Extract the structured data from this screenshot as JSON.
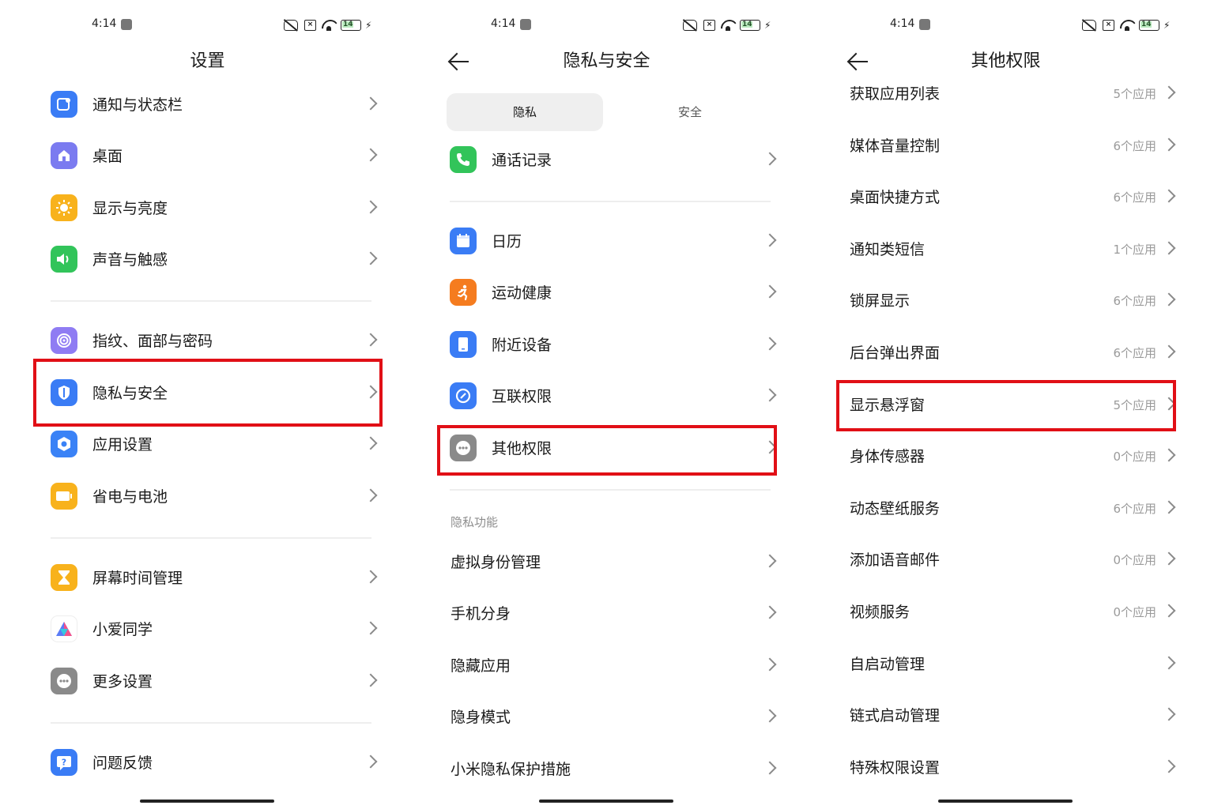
{
  "status_bar": {
    "time": "4:14",
    "battery": "14",
    "charging_symbol": "⚡"
  },
  "panel1": {
    "title": "设置",
    "items": [
      {
        "label": "通知与状态栏",
        "icon": "notification-icon",
        "color": "#3a7cf5"
      },
      {
        "label": "桌面",
        "icon": "home-icon",
        "color": "#7b7bf0"
      },
      {
        "label": "显示与亮度",
        "icon": "sun-icon",
        "color": "#f8b21c"
      },
      {
        "label": "声音与触感",
        "icon": "speaker-icon",
        "color": "#32c45a"
      },
      {
        "label": "指纹、面部与密码",
        "icon": "fingerprint-icon",
        "color": "#8f7cf3"
      },
      {
        "label": "隐私与安全",
        "icon": "shield-icon",
        "color": "#3a7cf5"
      },
      {
        "label": "应用设置",
        "icon": "app-settings-icon",
        "color": "#3a82f6"
      },
      {
        "label": "省电与电池",
        "icon": "battery-icon",
        "color": "#f8b21c"
      },
      {
        "label": "屏幕时间管理",
        "icon": "hourglass-icon",
        "color": "#f8b21c"
      },
      {
        "label": "小爱同学",
        "icon": "xiaoai-icon",
        "color": "#ffffff"
      },
      {
        "label": "更多设置",
        "icon": "more-icon",
        "color": "#8a8a8a"
      },
      {
        "label": "问题反馈",
        "icon": "feedback-icon",
        "color": "#3a7cf5"
      }
    ]
  },
  "panel2": {
    "title": "隐私与安全",
    "tabs": [
      "隐私",
      "安全"
    ],
    "items": [
      {
        "label": "通话记录",
        "icon": "phone-icon",
        "color": "#32c45a"
      },
      {
        "label": "日历",
        "icon": "calendar-icon",
        "color": "#3a7cf5"
      },
      {
        "label": "运动健康",
        "icon": "running-icon",
        "color": "#f57c1f"
      },
      {
        "label": "附近设备",
        "icon": "device-icon",
        "color": "#3a7cf5"
      },
      {
        "label": "互联权限",
        "icon": "link-icon",
        "color": "#3a7cf5"
      },
      {
        "label": "其他权限",
        "icon": "more-icon",
        "color": "#8a8a8a"
      }
    ],
    "section_label": "隐私功能",
    "section_items": [
      "虚拟身份管理",
      "手机分身",
      "隐藏应用",
      "隐身模式",
      "小米隐私保护措施"
    ]
  },
  "panel3": {
    "title": "其他权限",
    "items": [
      {
        "label": "获取应用列表",
        "count": "5个应用"
      },
      {
        "label": "媒体音量控制",
        "count": "6个应用"
      },
      {
        "label": "桌面快捷方式",
        "count": "6个应用"
      },
      {
        "label": "通知类短信",
        "count": "1个应用"
      },
      {
        "label": "锁屏显示",
        "count": "6个应用"
      },
      {
        "label": "后台弹出界面",
        "count": "6个应用"
      },
      {
        "label": "显示悬浮窗",
        "count": "5个应用"
      },
      {
        "label": "身体传感器",
        "count": "0个应用"
      },
      {
        "label": "动态壁纸服务",
        "count": "6个应用"
      },
      {
        "label": "添加语音邮件",
        "count": "0个应用"
      },
      {
        "label": "视频服务",
        "count": "0个应用"
      },
      {
        "label": "自启动管理",
        "count": ""
      },
      {
        "label": "链式启动管理",
        "count": ""
      },
      {
        "label": "特殊权限设置",
        "count": ""
      }
    ]
  },
  "highlight_color": "#e10f16"
}
